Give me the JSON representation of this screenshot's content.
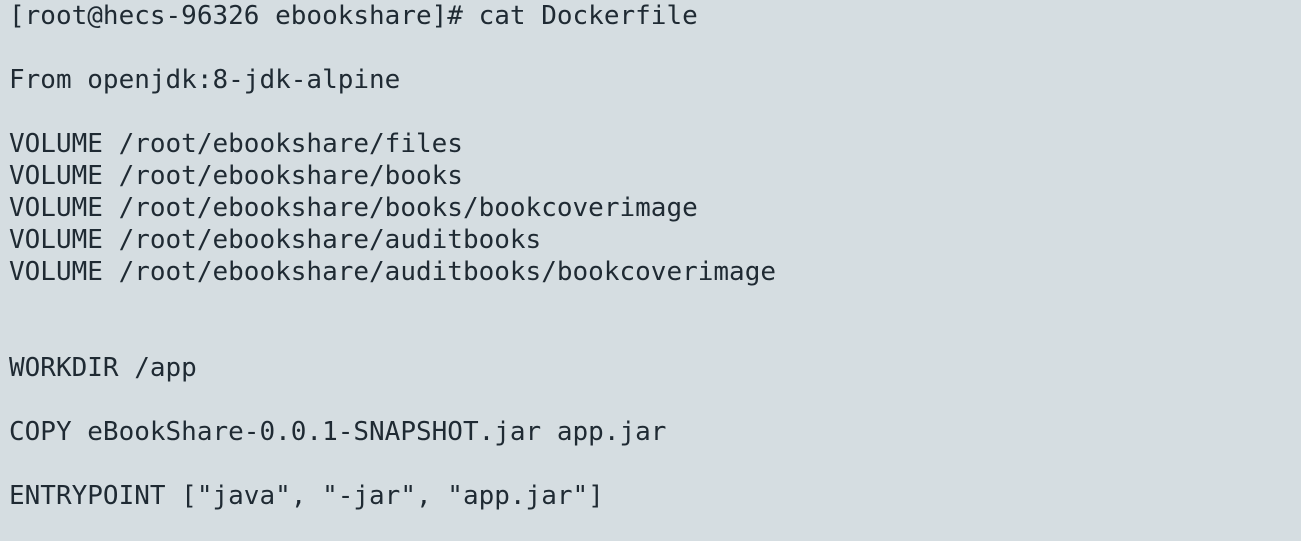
{
  "theme": {
    "background": "#d5dde1",
    "foreground": "#1f2a33"
  },
  "terminal": {
    "lines": [
      "[root@hecs-96326 ebookshare]# cat Dockerfile",
      "",
      "From openjdk:8-jdk-alpine",
      "",
      "VOLUME /root/ebookshare/files",
      "VOLUME /root/ebookshare/books",
      "VOLUME /root/ebookshare/books/bookcoverimage",
      "VOLUME /root/ebookshare/auditbooks",
      "VOLUME /root/ebookshare/auditbooks/bookcoverimage",
      "",
      "",
      "WORKDIR /app",
      "",
      "COPY eBookShare-0.0.1-SNAPSHOT.jar app.jar",
      "",
      "ENTRYPOINT [\"java\", \"-jar\", \"app.jar\"]"
    ]
  }
}
